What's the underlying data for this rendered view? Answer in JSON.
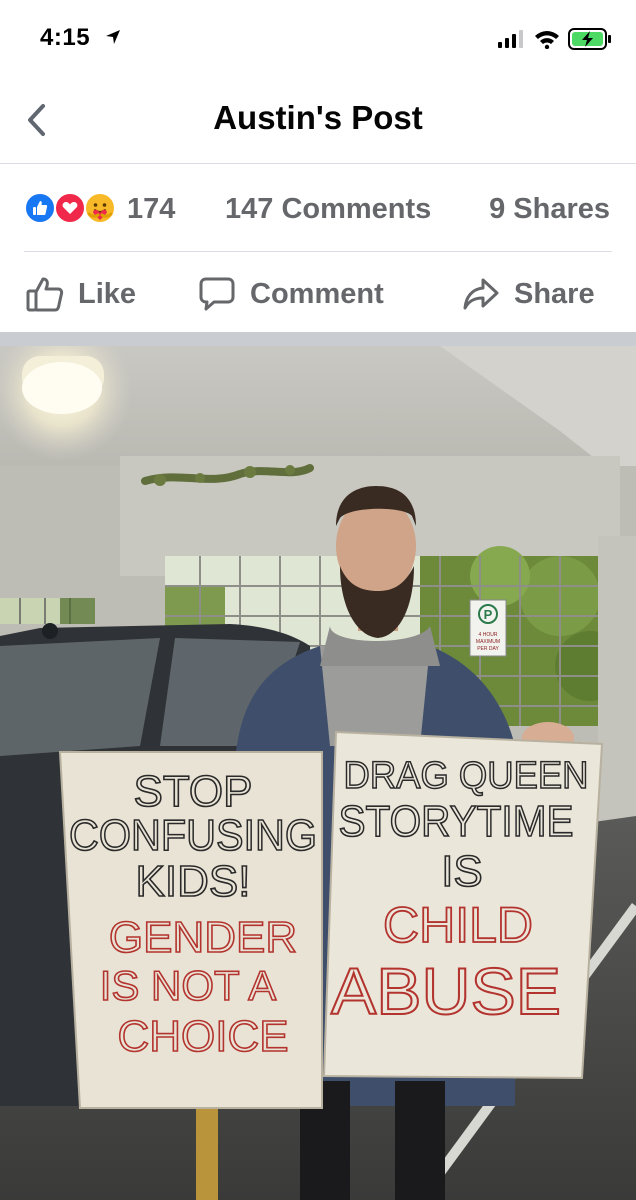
{
  "status_bar": {
    "time": "4:15"
  },
  "header": {
    "title": "Austin's Post"
  },
  "reactions": {
    "icons": [
      "like-reaction-icon",
      "love-reaction-icon",
      "care-reaction-icon"
    ],
    "count": "174",
    "comments": "147 Comments",
    "shares": "9 Shares"
  },
  "actions": {
    "like": "Like",
    "comment": "Comment",
    "share": "Share"
  },
  "photo": {
    "left_sign": [
      "STOP",
      "CONFUSING",
      "KIDS!",
      "GENDER",
      "IS NOT A",
      "CHOICE"
    ],
    "right_sign": [
      "DRAG QUEEN",
      "STORYTIME",
      "IS",
      "CHILD",
      "ABUSE"
    ],
    "parking_sign": {
      "letter": "P",
      "line1": "4 HOUR",
      "line2": "MAXIMUM",
      "line3": "PER DAY"
    }
  },
  "colors": {
    "like_blue": "#1877f2",
    "love_red": "#f02849",
    "care_yellow": "#f7b928",
    "meta_grey": "#65676b",
    "sign_black_ink": "#2a2a2a",
    "sign_red_ink": "#b3332e"
  }
}
